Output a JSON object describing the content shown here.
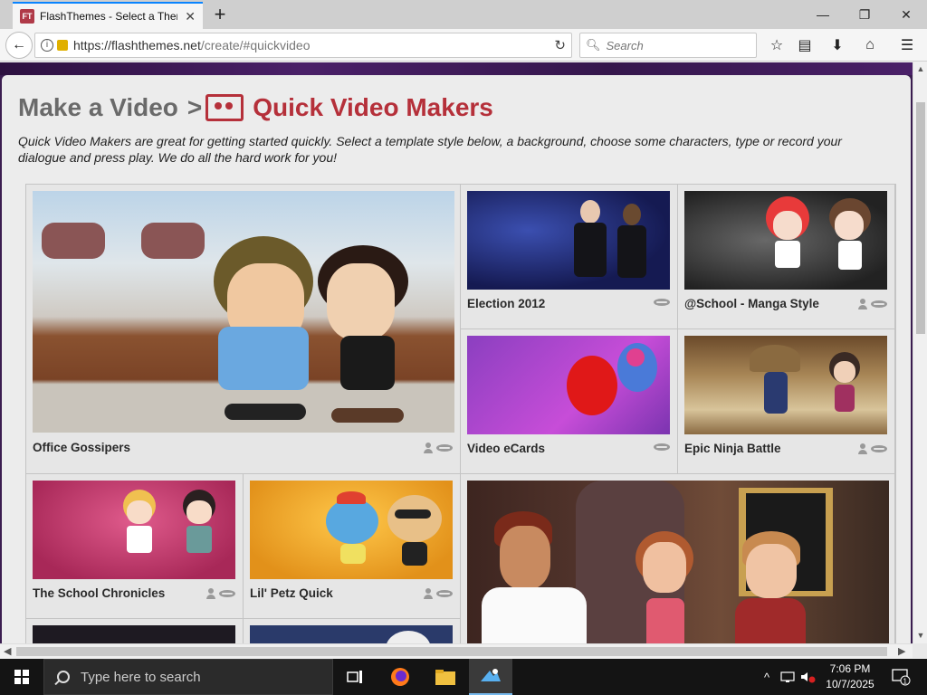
{
  "browser": {
    "tab_title": "FlashThemes - Select a Theme",
    "favicon_text": "FT",
    "url_domain": "https://flashthemes.net",
    "url_path": "/create/#quickvideo",
    "search_placeholder": "Search"
  },
  "page": {
    "breadcrumb_parent": "Make a Video",
    "breadcrumb_separator": ">",
    "title": "Quick Video Makers",
    "intro": "Quick Video Makers are great for getting started quickly. Select a template style below, a background, choose some characters, type or record your dialogue and press play. We do all the hard work for you!",
    "accent_color": "#b5303a"
  },
  "templates": [
    {
      "name": "Office Gossipers",
      "icons": [
        "person-icon",
        "lips-icon"
      ]
    },
    {
      "name": "Election 2012",
      "icons": [
        "lips-icon"
      ]
    },
    {
      "name": "@School - Manga Style",
      "icons": [
        "person-icon",
        "lips-icon"
      ]
    },
    {
      "name": "Video eCards",
      "icons": [
        "lips-icon"
      ]
    },
    {
      "name": "Epic Ninja Battle",
      "icons": [
        "person-icon",
        "lips-icon"
      ]
    },
    {
      "name": "The School Chronicles",
      "icons": [
        "person-icon",
        "lips-icon"
      ]
    },
    {
      "name": "Lil' Petz Quick",
      "icons": [
        "person-icon",
        "lips-icon"
      ]
    }
  ],
  "taskbar": {
    "search_placeholder": "Type here to search",
    "time": "7:06 PM",
    "date": "10/7/2025",
    "notification_count": "1"
  }
}
